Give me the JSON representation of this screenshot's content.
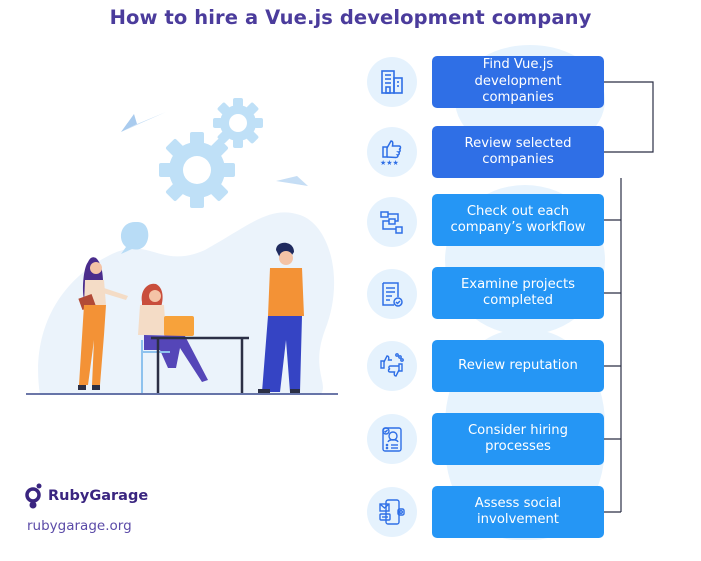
{
  "title": "How to hire a Vue.js development company",
  "steps": [
    {
      "label": "Find Vue.js development companies",
      "icon": "buildings-icon"
    },
    {
      "label": "Review selected companies",
      "icon": "thumbs-up-stars-icon"
    },
    {
      "label": "Check out each company’s workflow",
      "icon": "workflow-icon"
    },
    {
      "label": "Examine projects completed",
      "icon": "document-check-icon"
    },
    {
      "label": "Review reputation",
      "icon": "thumbs-up-down-icon"
    },
    {
      "label": "Consider hiring processes",
      "icon": "resume-profile-icon"
    },
    {
      "label": "Assess social involvement",
      "icon": "smartphone-social-icon"
    }
  ],
  "brand": {
    "name": "RubyGarage",
    "site": "rubygarage.org"
  },
  "colors": {
    "title": "#4b3c9c",
    "step_dark": "#2f6fe6",
    "step_light": "#2596f5",
    "icon_bg": "#e5f2fd",
    "connector": "#2b2f45"
  }
}
